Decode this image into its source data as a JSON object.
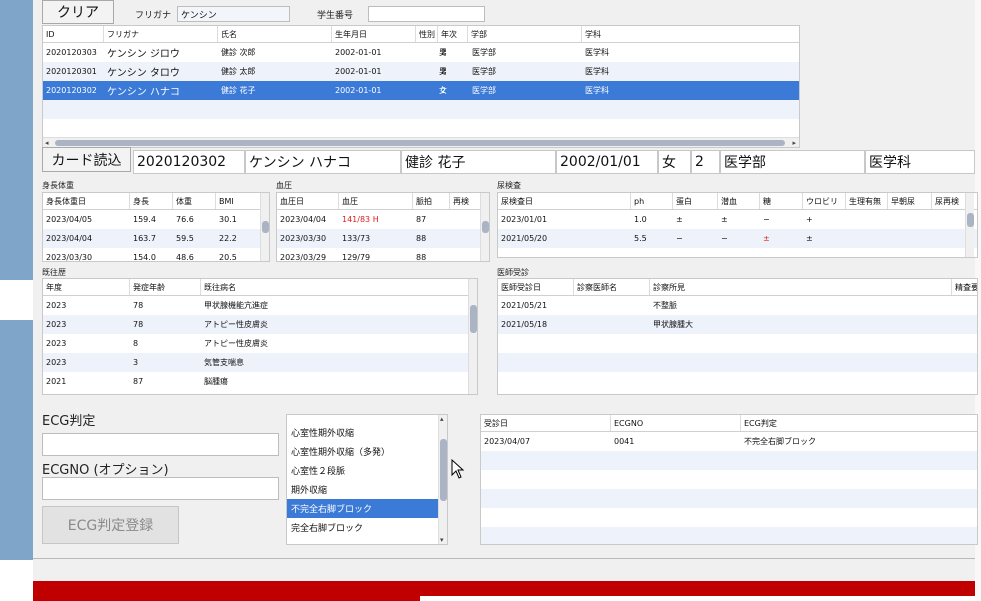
{
  "search": {
    "clear_label": "クリア",
    "furigana_label": "フリガナ",
    "furigana_value": "ケンシン",
    "student_no_label": "学生番号",
    "student_no_value": ""
  },
  "students": {
    "headers": [
      "ID",
      "フリガナ",
      "氏名",
      "生年月日",
      "性別",
      "年次",
      "学部",
      "学科"
    ],
    "rows": [
      [
        "2020120303",
        "ケンシン ジロウ",
        "健診 次郎",
        "2002-01-01",
        "男",
        "2",
        "医学部",
        "医学科"
      ],
      [
        "2020120301",
        "ケンシン タロウ",
        "健診 太郎",
        "2002-01-01",
        "男",
        "2",
        "医学部",
        "医学科"
      ],
      [
        "2020120302",
        "ケンシン ハナコ",
        "健診 花子",
        "2002-01-01",
        "女",
        "2",
        "医学部",
        "医学科"
      ]
    ]
  },
  "card": {
    "read_label": "カード読込",
    "id": "2020120302",
    "furigana": "ケンシン ハナコ",
    "name": "健診 花子",
    "birth": "2002/01/01",
    "sex": "女",
    "year": "2",
    "faculty": "医学部",
    "dept": "医学科"
  },
  "body": {
    "title": "身長体重",
    "headers": [
      "身長体重日",
      "身長",
      "体重",
      "BMI"
    ],
    "rows": [
      [
        "2023/04/05",
        "159.4",
        "76.6",
        "30.1"
      ],
      [
        "2023/04/04",
        "163.7",
        "59.5",
        "22.2"
      ],
      [
        "2023/03/30",
        "154.0",
        "48.6",
        "20.5"
      ]
    ]
  },
  "bp": {
    "title": "血圧",
    "headers": [
      "血圧日",
      "血圧",
      "脈拍",
      "再検"
    ],
    "rows": [
      [
        "2023/04/04",
        "141/83 H",
        "87",
        ""
      ],
      [
        "2023/03/30",
        "133/73",
        "88",
        ""
      ],
      [
        "2023/03/29",
        "129/79",
        "88",
        ""
      ]
    ]
  },
  "urine": {
    "title": "尿検査",
    "headers": [
      "尿検査日",
      "ph",
      "蛋白",
      "潜血",
      "糖",
      "ウロビリ",
      "生理有無",
      "早朝尿",
      "尿再検"
    ],
    "rows": [
      [
        "2023/01/01",
        "1.0",
        "±",
        "±",
        "−",
        "+",
        "",
        "",
        ""
      ],
      [
        "2021/05/20",
        "5.5",
        "−",
        "−",
        "±",
        "±",
        "",
        "",
        ""
      ]
    ]
  },
  "history": {
    "title": "既往歴",
    "headers": [
      "年度",
      "発症年齢",
      "既往病名"
    ],
    "rows": [
      [
        "2023",
        "78",
        "甲状腺機能亢進症"
      ],
      [
        "2023",
        "78",
        "アトピー性皮膚炎"
      ],
      [
        "2023",
        "8",
        "アトピー性皮膚炎"
      ],
      [
        "2023",
        "3",
        "気管支喘息"
      ],
      [
        "2021",
        "87",
        "脳腫瘍"
      ]
    ]
  },
  "doctor": {
    "title": "医師受診",
    "headers": [
      "医師受診日",
      "診察医師名",
      "診察所見",
      "精査要"
    ],
    "rows": [
      [
        "2021/05/21",
        "",
        "不整脈",
        ""
      ],
      [
        "2021/05/18",
        "",
        "甲状腺腫大",
        ""
      ]
    ]
  },
  "ecg_form": {
    "judgement_label": "ECG判定",
    "judgement_value": "",
    "ecgno_label": "ECGNO (オプション)",
    "ecgno_value": "",
    "register_label": "ECG判定登録"
  },
  "ecg_list": {
    "items": [
      "心室性期外収縮",
      "心室性期外収縮（多発）",
      "心室性２段脈",
      "期外収縮",
      "不完全右脚ブロック",
      "完全右脚ブロック"
    ],
    "selected": "不完全右脚ブロック"
  },
  "ecg_table": {
    "headers": [
      "受診日",
      "ECGNO",
      "ECG判定"
    ],
    "rows": [
      [
        "2023/04/07",
        "0041",
        "不完全右脚ブロック"
      ]
    ]
  },
  "colors": {
    "selection": "#3b7ad7",
    "alt_row": "#eef3fb",
    "banner": "#c00000",
    "high": "#e02020"
  }
}
